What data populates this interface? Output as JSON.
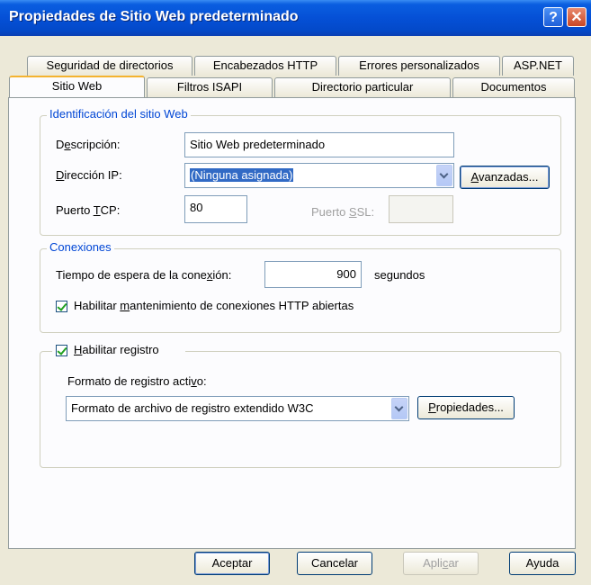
{
  "window": {
    "title": "Propiedades de Sitio Web predeterminado",
    "help_glyph": "?",
    "close_glyph": "✕"
  },
  "tabs_back": [
    {
      "label": "Seguridad de directorios"
    },
    {
      "label": "Encabezados HTTP"
    },
    {
      "label": "Errores personalizados"
    },
    {
      "label": "ASP.NET"
    }
  ],
  "tabs_front": [
    {
      "label": "Sitio Web",
      "active": true
    },
    {
      "label": "Filtros ISAPI"
    },
    {
      "label": "Directorio particular"
    },
    {
      "label": "Documentos"
    }
  ],
  "identification": {
    "legend": "Identificación del sitio Web",
    "description_label_pre": "D",
    "description_label_u": "e",
    "description_label_post": "scripción:",
    "description_value": "Sitio Web predeterminado",
    "ip_label_pre": "",
    "ip_label_u": "D",
    "ip_label_post": "irección IP:",
    "ip_value": "(Ninguna asignada)",
    "advanced_pre": "",
    "advanced_u": "A",
    "advanced_post": "vanzadas...",
    "tcp_label_pre": "Puerto ",
    "tcp_label_u": "T",
    "tcp_label_post": "CP:",
    "tcp_value": "80",
    "ssl_label_pre": "Puerto ",
    "ssl_label_u": "S",
    "ssl_label_post": "SL:",
    "ssl_value": ""
  },
  "connections": {
    "legend": "Conexiones",
    "timeout_label_pre": "Tiempo de espera de la cone",
    "timeout_label_u": "x",
    "timeout_label_post": "ión:",
    "timeout_value": "900",
    "timeout_unit": "segundos",
    "keepalive_checked": true,
    "keepalive_pre": "Habilitar ",
    "keepalive_u": "m",
    "keepalive_post": "antenimiento de conexiones HTTP abiertas"
  },
  "logging": {
    "enable_checked": true,
    "enable_pre": "",
    "enable_u": "H",
    "enable_post": "abilitar registro",
    "format_label_pre": "Formato de registro acti",
    "format_label_u": "v",
    "format_label_post": "o:",
    "format_value": "Formato de archivo de registro extendido W3C",
    "properties_pre": "",
    "properties_u": "P",
    "properties_post": "ropiedades..."
  },
  "footer": {
    "ok": "Aceptar",
    "cancel": "Cancelar",
    "apply_pre": "Apli",
    "apply_u": "c",
    "apply_post": "ar",
    "help": "Ayuda"
  },
  "colors": {
    "titlebar": "#0550d6",
    "legend_text": "#0046d5",
    "dialog_bg": "#ece9d8",
    "active_tab_accent": "#f4b330"
  }
}
